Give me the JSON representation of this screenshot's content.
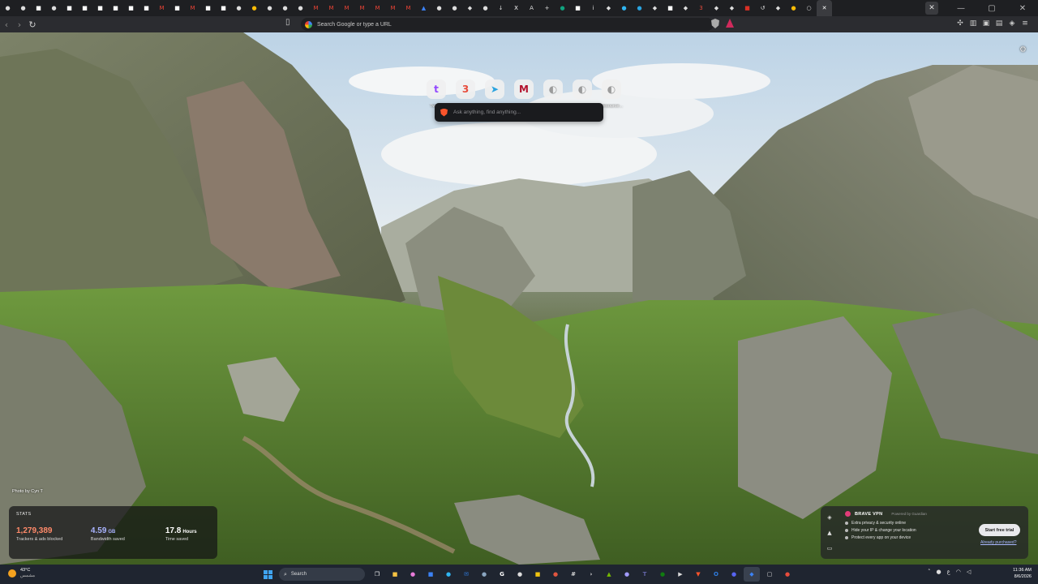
{
  "browser": {
    "tabs": [
      {
        "icon": "github-icon",
        "color": "#dddddd",
        "glyph": "●"
      },
      {
        "icon": "github-icon",
        "color": "#dddddd",
        "glyph": "●"
      },
      {
        "icon": "doc-icon",
        "color": "#ffffff",
        "glyph": "■"
      },
      {
        "icon": "github-icon",
        "color": "#dddddd",
        "glyph": "●"
      },
      {
        "icon": "doc-icon",
        "color": "#ffffff",
        "glyph": "■"
      },
      {
        "icon": "doc-icon",
        "color": "#ffffff",
        "glyph": "■"
      },
      {
        "icon": "doc-icon",
        "color": "#ffffff",
        "glyph": "■"
      },
      {
        "icon": "doc-icon",
        "color": "#ffffff",
        "glyph": "■"
      },
      {
        "icon": "doc-icon",
        "color": "#ffffff",
        "glyph": "■"
      },
      {
        "icon": "doc-icon",
        "color": "#ffffff",
        "glyph": "■"
      },
      {
        "icon": "gmail-icon",
        "color": "#ea4335",
        "glyph": "M"
      },
      {
        "icon": "doc-icon",
        "color": "#ffffff",
        "glyph": "■"
      },
      {
        "icon": "gmail-icon",
        "color": "#ea4335",
        "glyph": "M"
      },
      {
        "icon": "doc-icon",
        "color": "#ffffff",
        "glyph": "■"
      },
      {
        "icon": "doc-icon",
        "color": "#ffffff",
        "glyph": "■"
      },
      {
        "icon": "github-icon",
        "color": "#dddddd",
        "glyph": "●"
      },
      {
        "icon": "chrome-icon",
        "color": "#fbbc05",
        "glyph": "●"
      },
      {
        "icon": "github-icon",
        "color": "#dddddd",
        "glyph": "●"
      },
      {
        "icon": "github-icon",
        "color": "#dddddd",
        "glyph": "●"
      },
      {
        "icon": "github-icon",
        "color": "#dddddd",
        "glyph": "●"
      },
      {
        "icon": "gmail-icon",
        "color": "#ea4335",
        "glyph": "M"
      },
      {
        "icon": "gmail-icon",
        "color": "#ea4335",
        "glyph": "M"
      },
      {
        "icon": "gmail-icon",
        "color": "#ea4335",
        "glyph": "M"
      },
      {
        "icon": "gmail-icon",
        "color": "#ea4335",
        "glyph": "M"
      },
      {
        "icon": "gmail-icon",
        "color": "#ea4335",
        "glyph": "M"
      },
      {
        "icon": "gmail-icon",
        "color": "#ea4335",
        "glyph": "M"
      },
      {
        "icon": "gmail-icon",
        "color": "#ea4335",
        "glyph": "M"
      },
      {
        "icon": "drive-icon",
        "color": "#3b82f6",
        "glyph": "▲"
      },
      {
        "icon": "github-icon",
        "color": "#dddddd",
        "glyph": "●"
      },
      {
        "icon": "github-icon",
        "color": "#dddddd",
        "glyph": "●"
      },
      {
        "icon": "shield-icon",
        "color": "#dddddd",
        "glyph": "◆"
      },
      {
        "icon": "github-icon",
        "color": "#dddddd",
        "glyph": "●"
      },
      {
        "icon": "download-icon",
        "color": "#dddddd",
        "glyph": "↓"
      },
      {
        "icon": "x-icon",
        "color": "#ffffff",
        "glyph": "X"
      },
      {
        "icon": "translate-icon",
        "color": "#dddddd",
        "glyph": "A"
      },
      {
        "icon": "plus-icon",
        "color": "#dddddd",
        "glyph": "+"
      },
      {
        "icon": "chatgpt-icon",
        "color": "#10a37f",
        "glyph": "●"
      },
      {
        "icon": "doc-icon",
        "color": "#ffffff",
        "glyph": "■"
      },
      {
        "icon": "info-icon",
        "color": "#dddddd",
        "glyph": "i"
      },
      {
        "icon": "shield-icon",
        "color": "#dddddd",
        "glyph": "◆"
      },
      {
        "icon": "edge-icon",
        "color": "#2fb5f2",
        "glyph": "●"
      },
      {
        "icon": "telegram-icon",
        "color": "#2aa3df",
        "glyph": "●"
      },
      {
        "icon": "shield-icon",
        "color": "#dddddd",
        "glyph": "◆"
      },
      {
        "icon": "doc-icon",
        "color": "#ffffff",
        "glyph": "■"
      },
      {
        "icon": "shield-icon",
        "color": "#dddddd",
        "glyph": "◆"
      },
      {
        "icon": "three-icon",
        "color": "#e74c3c",
        "glyph": "3"
      },
      {
        "icon": "shield-icon",
        "color": "#dddddd",
        "glyph": "◆"
      },
      {
        "icon": "shield-icon",
        "color": "#dddddd",
        "glyph": "◆"
      },
      {
        "icon": "adblock-icon",
        "color": "#d93025",
        "glyph": "■"
      },
      {
        "icon": "history-icon",
        "color": "#dddddd",
        "glyph": "↺"
      },
      {
        "icon": "shield-icon",
        "color": "#dddddd",
        "glyph": "◆"
      },
      {
        "icon": "chrome-icon",
        "color": "#fbbc05",
        "glyph": "●"
      },
      {
        "icon": "loading-icon",
        "color": "#dddddd",
        "glyph": "○"
      },
      {
        "icon": "brave-icon",
        "color": "#ffffff",
        "glyph": "✕"
      }
    ],
    "window_controls": {
      "minimize": "—",
      "maximize": "▢",
      "close": "✕"
    },
    "tab_close_glyph": "✕",
    "omnibox_placeholder": "Search Google or type a URL"
  },
  "ntp": {
    "top_sites": [
      {
        "label": "Twitch",
        "glyph": "t",
        "color": "#9146ff"
      },
      {
        "label": "One Piece...",
        "glyph": "3",
        "color": "#e74c3c"
      },
      {
        "label": "Telegram...",
        "glyph": "➤",
        "color": "#2aa3df"
      },
      {
        "label": "Qu'ils M...",
        "glyph": "M",
        "color": "#b3122d"
      },
      {
        "label": "Game deals",
        "glyph": "◐",
        "color": "#9b9b9b"
      },
      {
        "label": "Brave Talk",
        "glyph": "◐",
        "color": "#9b9b9b"
      },
      {
        "label": "Resource...",
        "glyph": "◐",
        "color": "#9b9b9b"
      }
    ],
    "search_placeholder": "Ask anything, find anything...",
    "photo_credit": "Photo by Cyn T",
    "stats": {
      "title": "STATS",
      "items": [
        {
          "value": "1,279,389",
          "unit": "",
          "label": "Trackers & ads blocked",
          "color": "#ff8a6a"
        },
        {
          "value": "4.59",
          "unit": "GB",
          "label": "Bandwidth saved",
          "color": "#a9b4ff"
        },
        {
          "value": "17.8",
          "unit": "Hours",
          "label": "Time saved",
          "color": "#ffffff"
        }
      ]
    },
    "vpn": {
      "title": "BRAVE VPN",
      "powered": "Powered by Guardian",
      "features": [
        "Extra privacy & security online",
        "Hide your IP & change your location",
        "Protect every app on your device"
      ],
      "cta": "Start free trial",
      "already": "Already purchased?"
    }
  },
  "taskbar": {
    "weather_temp": "43°C",
    "weather_sub": "مشمس",
    "search_label": "Search",
    "apps": [
      {
        "icon": "task-view-icon",
        "color": "#ffffff",
        "glyph": "❐"
      },
      {
        "icon": "file-explorer-icon",
        "color": "#f6c343",
        "glyph": "■"
      },
      {
        "icon": "copilot-icon",
        "color": "#e87bd9",
        "glyph": "●"
      },
      {
        "icon": "store-icon",
        "color": "#3b82f6",
        "glyph": "■"
      },
      {
        "icon": "edge-icon",
        "color": "#2fb5f2",
        "glyph": "●"
      },
      {
        "icon": "mail-icon",
        "color": "#2f7de1",
        "glyph": "✉"
      },
      {
        "icon": "steam-icon",
        "color": "#8aa6c1",
        "glyph": "●"
      },
      {
        "icon": "google-icon",
        "color": "#ffffff",
        "glyph": "G"
      },
      {
        "icon": "obs-icon",
        "color": "#dddddd",
        "glyph": "●"
      },
      {
        "icon": "sticky-icon",
        "color": "#f1c40f",
        "glyph": "■"
      },
      {
        "icon": "chrome-icon",
        "color": "#e0553f",
        "glyph": "●"
      },
      {
        "icon": "calculator-icon",
        "color": "#dddddd",
        "glyph": "#"
      },
      {
        "icon": "terminal-icon",
        "color": "#dddddd",
        "glyph": "›"
      },
      {
        "icon": "nvidia-icon",
        "color": "#76b900",
        "glyph": "▲"
      },
      {
        "icon": "app-icon",
        "color": "#a29bfe",
        "glyph": "●"
      },
      {
        "icon": "teams-icon",
        "color": "#6264a7",
        "glyph": "T"
      },
      {
        "icon": "xbox-icon",
        "color": "#107c10",
        "glyph": "●"
      },
      {
        "icon": "play-icon",
        "color": "#dddddd",
        "glyph": "▶"
      },
      {
        "icon": "brave-icon",
        "color": "#fb542b",
        "glyph": "▼"
      },
      {
        "icon": "outlook-icon",
        "color": "#2f7de1",
        "glyph": "O"
      },
      {
        "icon": "discord-icon",
        "color": "#5865f2",
        "glyph": "●"
      },
      {
        "icon": "brave-browser-icon",
        "color": "#3b82f6",
        "glyph": "◆"
      },
      {
        "icon": "devices-icon",
        "color": "#dddddd",
        "glyph": "▢"
      },
      {
        "icon": "record-icon",
        "color": "#e74c3c",
        "glyph": "●"
      }
    ],
    "tray_chevron": "˄",
    "tray_lang": "ع",
    "time": "11:36 AM",
    "date": "8/6/2026"
  }
}
